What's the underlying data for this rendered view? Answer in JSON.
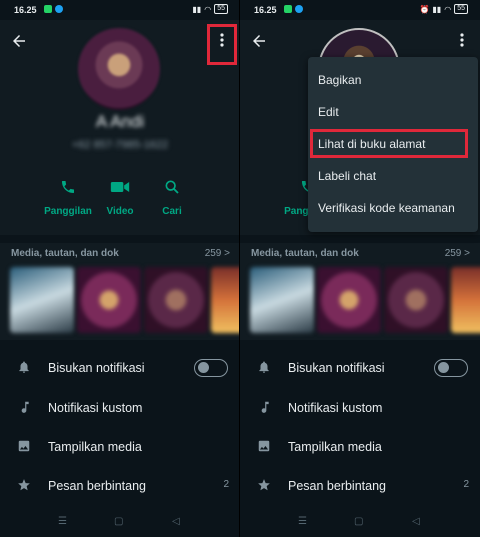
{
  "status_bar": {
    "time": "16.25",
    "battery": "55"
  },
  "contact": {
    "name": "A Andi",
    "phone": "+62 857-7985-1622"
  },
  "actions": [
    {
      "label": "Panggilan",
      "icon": "phone-icon"
    },
    {
      "label": "Video",
      "icon": "video-icon"
    },
    {
      "label": "Cari",
      "icon": "search-icon"
    }
  ],
  "media": {
    "title": "Media, tautan, dan dok",
    "count": "259 >"
  },
  "settings": [
    {
      "label": "Bisukan notifikasi",
      "icon": "bell-icon",
      "value": ""
    },
    {
      "label": "Notifikasi kustom",
      "icon": "music-note-icon",
      "value": ""
    },
    {
      "label": "Tampilkan media",
      "icon": "image-icon",
      "value": ""
    },
    {
      "label": "Pesan berbintang",
      "icon": "star-icon",
      "value": "2"
    }
  ],
  "menu": {
    "items": [
      {
        "label": "Bagikan"
      },
      {
        "label": "Edit"
      },
      {
        "label": "Lihat di buku alamat"
      },
      {
        "label": "Labeli chat"
      },
      {
        "label": "Verifikasi kode keamanan"
      }
    ]
  },
  "colors": {
    "accent": "#00a884",
    "highlight": "#e0283a",
    "menu_bg": "#233138"
  }
}
